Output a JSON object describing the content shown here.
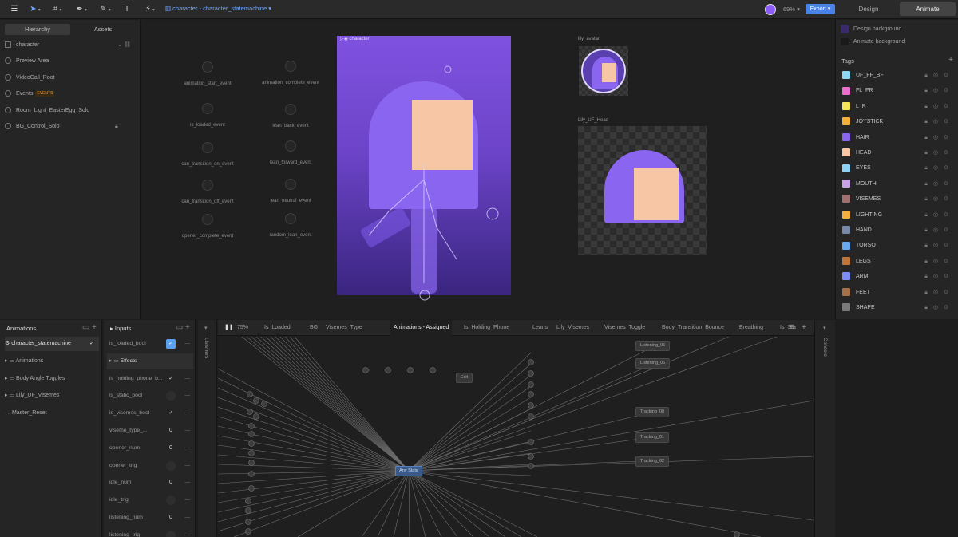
{
  "toolbar": {
    "file_breadcrumb": "character - character_statemachine",
    "zoom": "69%",
    "export_label": "Export",
    "mode_design": "Design",
    "mode_animate": "Animate"
  },
  "hierarchy": {
    "tab_hierarchy": "Hierarchy",
    "tab_assets": "Assets",
    "rows": [
      {
        "label": "character"
      },
      {
        "label": "Preview Area"
      },
      {
        "label": "VideoCall_Root"
      },
      {
        "label": "Events",
        "badge": "EVENTS"
      },
      {
        "label": "Room_Light_EasterEgg_Solo"
      },
      {
        "label": "BG_Control_Solo"
      }
    ]
  },
  "canvas": {
    "events_left": [
      "animation_start_event",
      "is_loaded_event",
      "can_transition_on_event",
      "can_transition_off_event",
      "opener_complete_event"
    ],
    "events_right": [
      "animation_complete_event",
      "lean_back_event",
      "lean_forward_event",
      "lean_neutral_event",
      "random_lean_event"
    ],
    "artboard_label": "character",
    "avatar_label": "lily_avatar",
    "head_label": "Lily_UF_Head"
  },
  "right_panel": {
    "bg_design": "Design background",
    "bg_animate": "Animate background",
    "tags_title": "Tags",
    "tags": [
      {
        "name": "UF_FF_BF",
        "color": "#8fd8f5"
      },
      {
        "name": "FL_FR",
        "color": "#e86fd0"
      },
      {
        "name": "L_R",
        "color": "#f5e35a"
      },
      {
        "name": "JOYSTICK",
        "color": "#f2b13e"
      },
      {
        "name": "HAIR",
        "color": "#8a66f0"
      },
      {
        "name": "HEAD",
        "color": "#f6c6a5"
      },
      {
        "name": "EYES",
        "color": "#8fd0f5"
      },
      {
        "name": "MOUTH",
        "color": "#c9a3e8"
      },
      {
        "name": "VISEMES",
        "color": "#a07070"
      },
      {
        "name": "LIGHTING",
        "color": "#f2b13e"
      },
      {
        "name": "HAND",
        "color": "#7a88a8"
      },
      {
        "name": "TORSO",
        "color": "#6aa8f0"
      },
      {
        "name": "LEGS",
        "color": "#c0763a"
      },
      {
        "name": "ARM",
        "color": "#7d8ff0"
      },
      {
        "name": "FEET",
        "color": "#a87048"
      },
      {
        "name": "SHAPE",
        "color": "#7a7a7a"
      }
    ]
  },
  "animations": {
    "title": "Animations",
    "items": [
      {
        "label": "character_statemachine"
      },
      {
        "label": "Animations"
      },
      {
        "label": "Body Angle Toggles"
      },
      {
        "label": "Lily_UF_Visemes"
      },
      {
        "label": "Master_Reset"
      }
    ]
  },
  "inputs": {
    "title": "Inputs",
    "items": [
      {
        "label": "is_loaded_bool",
        "value": "✓",
        "kind": "on"
      },
      {
        "label": "Effects",
        "value": "",
        "kind": "group"
      },
      {
        "label": "is_holding_phone_b...",
        "value": "✓",
        "kind": "check"
      },
      {
        "label": "is_static_bool",
        "value": "",
        "kind": "off"
      },
      {
        "label": "is_visemes_bool",
        "value": "✓",
        "kind": "check"
      },
      {
        "label": "viseme_type_...",
        "value": "0",
        "kind": "num"
      },
      {
        "label": "opener_num",
        "value": "0",
        "kind": "num"
      },
      {
        "label": "opener_trig",
        "value": "",
        "kind": "off"
      },
      {
        "label": "idle_num",
        "value": "0",
        "kind": "num"
      },
      {
        "label": "idle_trig",
        "value": "",
        "kind": "off"
      },
      {
        "label": "listening_num",
        "value": "0",
        "kind": "num"
      },
      {
        "label": "listening_trig",
        "value": "",
        "kind": "off"
      }
    ]
  },
  "side_labels": {
    "listeners": "Listeners",
    "console": "Console"
  },
  "graph": {
    "zoom": "75%",
    "tabs": [
      "Is_Loaded",
      "BG",
      "Visemes_Type",
      "Animations - Assigned",
      "Is_Holding_Phone",
      "Leans",
      "Lily_Visemes",
      "Visemes_Toggle",
      "Body_Transition_Bounce",
      "Breathing",
      "Is_Sta"
    ],
    "active_tab": "Animations - Assigned",
    "any_state": "Any State",
    "exit": "Exit",
    "nodes": [
      "Listening_05",
      "Listening_06",
      "Tracking_00",
      "Tracking_01",
      "Tracking_02"
    ]
  }
}
